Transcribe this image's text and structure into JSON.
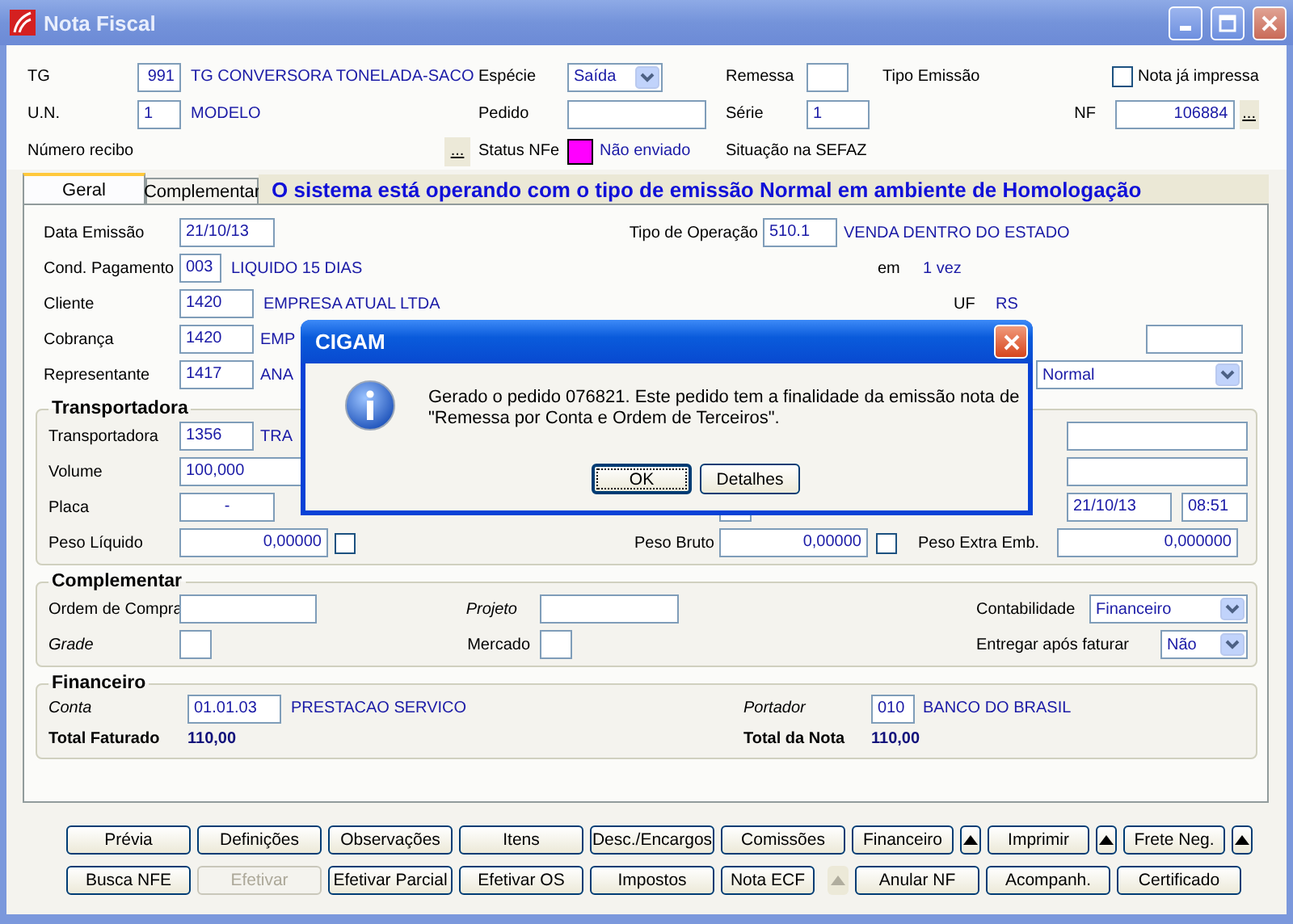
{
  "window": {
    "title": "Nota Fiscal"
  },
  "header": {
    "tg": {
      "label": "TG",
      "code": "991",
      "name": "TG CONVERSORA TONELADA-SACO"
    },
    "especie": {
      "label": "Espécie",
      "value": "Saída"
    },
    "remessa": {
      "label": "Remessa"
    },
    "tipo_emissao": {
      "label": "Tipo Emissão"
    },
    "nota_ja_impressa": {
      "label": "Nota já impressa",
      "checked": false
    },
    "un": {
      "label": "U.N.",
      "code": "1",
      "name": "MODELO"
    },
    "pedido": {
      "label": "Pedido"
    },
    "serie": {
      "label": "Série",
      "value": "1"
    },
    "nf": {
      "label": "NF",
      "value": "106884",
      "button": "..."
    },
    "numero_recibo": {
      "label": "Número recibo",
      "button": "..."
    },
    "status_nfe": {
      "label": "Status NFe",
      "color": "#ff00ff",
      "value": "Não enviado"
    },
    "situacao_sefaz": {
      "label": "Situação na SEFAZ"
    }
  },
  "tabs": [
    {
      "label": "Geral",
      "selected": true
    },
    {
      "label": "Complementar",
      "selected": false
    }
  ],
  "banner": "O sistema está operando com o tipo de emissão Normal em ambiente de Homologação",
  "geral": {
    "data_emissao": {
      "label": "Data Emissão",
      "value": "21/10/13"
    },
    "tipo_operacao": {
      "label": "Tipo de Operação",
      "code": "510.1",
      "name": "VENDA DENTRO DO ESTADO"
    },
    "cond_pagamento": {
      "label": "Cond. Pagamento",
      "code": "003",
      "name": "LIQUIDO 15 DIAS"
    },
    "parcelas": {
      "label": "em",
      "value": "1 vez"
    },
    "cliente": {
      "label": "Cliente",
      "code": "1420",
      "name": "EMPRESA ATUAL LTDA"
    },
    "uf": {
      "label": "UF",
      "value": "RS"
    },
    "cobranca": {
      "label": "Cobrança",
      "code": "1420",
      "name": "EMP"
    },
    "representante": {
      "label": "Representante",
      "code": "1417",
      "name": "ANA"
    },
    "combo_1": {
      "value": "Normal"
    }
  },
  "transportadora": {
    "title": "Transportadora",
    "transportadora": {
      "label": "Transportadora",
      "code": "1356",
      "name": "TRA"
    },
    "volume": {
      "label": "Volume",
      "value": "100,000"
    },
    "placa": {
      "label": "Placa",
      "value": "-"
    },
    "date": "21/10/13",
    "time": "08:51",
    "peso_liquido": {
      "label": "Peso Líquido",
      "value": "0,00000",
      "checked": false
    },
    "peso_bruto": {
      "label": "Peso Bruto",
      "value": "0,00000",
      "checked": false
    },
    "peso_extra_emb": {
      "label": "Peso Extra Emb.",
      "value": "0,000000"
    }
  },
  "complementar": {
    "title": "Complementar",
    "ordem_compra": {
      "label": "Ordem de Compra"
    },
    "projeto": {
      "label": "Projeto"
    },
    "contabilidade": {
      "label": "Contabilidade",
      "value": "Financeiro"
    },
    "grade": {
      "label": "Grade"
    },
    "mercado": {
      "label": "Mercado"
    },
    "entregar_apos_faturar": {
      "label": "Entregar após faturar",
      "value": "Não"
    }
  },
  "financeiro": {
    "title": "Financeiro",
    "conta": {
      "label": "Conta",
      "code": "01.01.03",
      "name": "PRESTACAO SERVICO"
    },
    "portador": {
      "label": "Portador",
      "code": "010",
      "name": "BANCO DO BRASIL"
    },
    "total_faturado": {
      "label": "Total Faturado",
      "value": "110,00"
    },
    "total_nota": {
      "label": "Total da Nota",
      "value": "110,00"
    }
  },
  "button_rows": [
    [
      {
        "kind": "button",
        "label": "Prévia",
        "disabled": false
      },
      {
        "kind": "button",
        "label": "Definições",
        "disabled": false
      },
      {
        "kind": "button",
        "label": "Observações",
        "disabled": false
      },
      {
        "kind": "button",
        "label": "Itens",
        "disabled": false
      },
      {
        "kind": "button",
        "label": "Desc./Encargos",
        "disabled": false
      },
      {
        "kind": "button",
        "label": "Comissões",
        "disabled": false
      },
      {
        "kind": "button",
        "label": "Financeiro",
        "disabled": false
      },
      {
        "kind": "arrow",
        "disabled": false
      },
      {
        "kind": "button",
        "label": "Imprimir",
        "disabled": false
      },
      {
        "kind": "arrow",
        "disabled": false
      },
      {
        "kind": "button",
        "label": "Frete Neg.",
        "disabled": false
      },
      {
        "kind": "arrow",
        "disabled": false
      }
    ],
    [
      {
        "kind": "button",
        "label": "Busca NFE",
        "disabled": false
      },
      {
        "kind": "button",
        "label": "Efetivar",
        "disabled": true
      },
      {
        "kind": "button",
        "label": "Efetivar Parcial",
        "disabled": false
      },
      {
        "kind": "button",
        "label": "Efetivar OS",
        "disabled": false
      },
      {
        "kind": "button",
        "label": "Impostos",
        "disabled": false
      },
      {
        "kind": "button",
        "label": "Nota ECF",
        "disabled": false
      },
      {
        "kind": "arrow",
        "disabled": true
      },
      {
        "kind": "button",
        "label": "Anular NF",
        "disabled": false
      },
      {
        "kind": "button",
        "label": "Acompanh.",
        "disabled": false
      },
      {
        "kind": "button",
        "label": "Certificado",
        "disabled": false
      }
    ]
  ],
  "dialog": {
    "title": "CIGAM",
    "message": "Gerado o pedido 076821. Este pedido tem a finalidade da emissão nota de\n\"Remessa por Conta e Ordem de Terceiros\".",
    "buttons": [
      {
        "label": "OK",
        "focused": true
      },
      {
        "label": "Detalhes",
        "focused": false
      }
    ]
  }
}
